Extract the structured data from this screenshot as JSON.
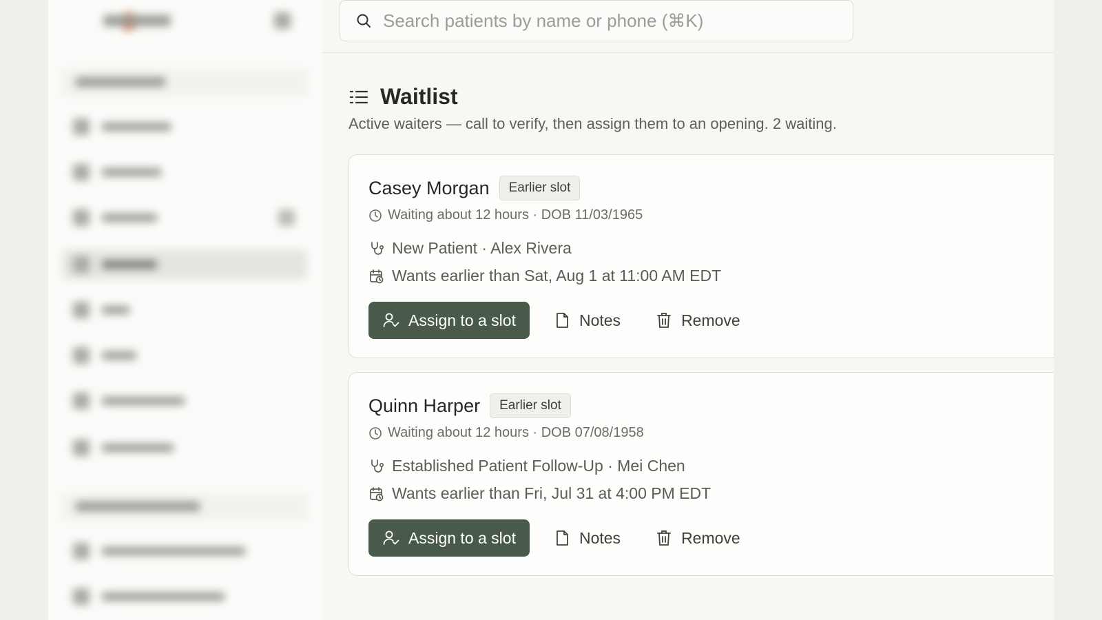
{
  "search": {
    "placeholder": "Search patients by name or phone (⌘K)"
  },
  "page": {
    "title": "Waitlist",
    "subtitle": "Active waiters — call to verify, then assign them to an opening. 2 waiting."
  },
  "waiters": [
    {
      "name": "Casey Morgan",
      "badge": "Earlier slot",
      "meta": "Waiting about 12 hours · DOB 11/03/1965",
      "visit": "New Patient · Alex Rivera",
      "wants": "Wants earlier than Sat, Aug 1 at 11:00 AM EDT"
    },
    {
      "name": "Quinn Harper",
      "badge": "Earlier slot",
      "meta": "Waiting about 12 hours · DOB 07/08/1958",
      "visit": "Established Patient Follow-Up · Mei Chen",
      "wants": "Wants earlier than Fri, Jul 31 at 4:00 PM EDT"
    }
  ],
  "actions": {
    "assign_label": "Assign to a slot",
    "notes_label": "Notes",
    "remove_label": "Remove"
  },
  "colors": {
    "primary_button": "#4a5a4a",
    "page_background": "#f8f7f4",
    "card_background": "#fdfdfb"
  },
  "icons": {
    "search": "search-icon",
    "list": "list-icon",
    "clock": "clock-icon",
    "stethoscope": "stethoscope-icon",
    "calendar": "calendar-clock-icon",
    "assign": "user-check-icon",
    "notes": "file-icon",
    "remove": "trash-icon"
  }
}
